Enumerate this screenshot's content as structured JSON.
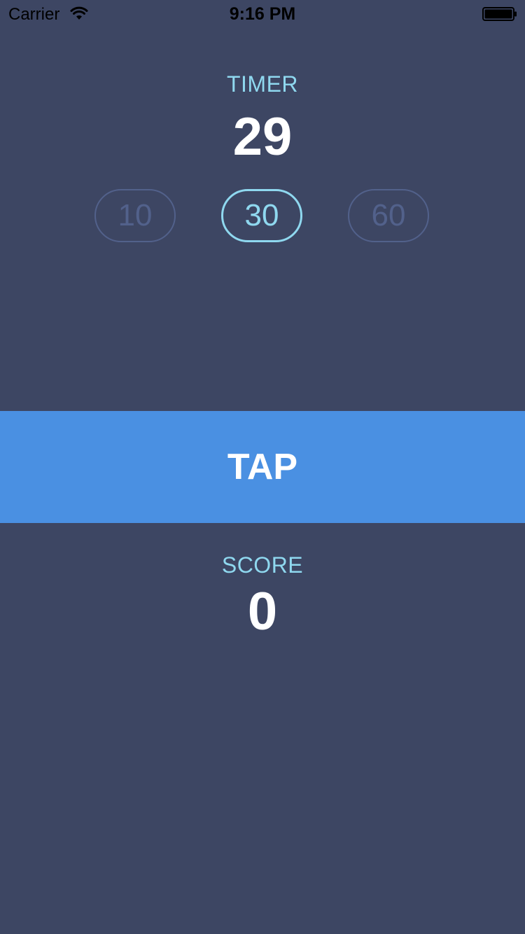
{
  "status_bar": {
    "carrier": "Carrier",
    "time": "9:16 PM",
    "wifi_icon": "wifi-icon",
    "battery_icon": "battery-icon"
  },
  "timer": {
    "label": "TIMER",
    "value": "29",
    "options": [
      "10",
      "30",
      "60"
    ],
    "selected": "30"
  },
  "tap_button": {
    "label": "TAP"
  },
  "score": {
    "label": "SCORE",
    "value": "0"
  },
  "colors": {
    "background": "#3d4663",
    "accent": "#8fd8ef",
    "button": "#4a90e2",
    "inactive_option": "#52618b",
    "text": "#ffffff"
  }
}
